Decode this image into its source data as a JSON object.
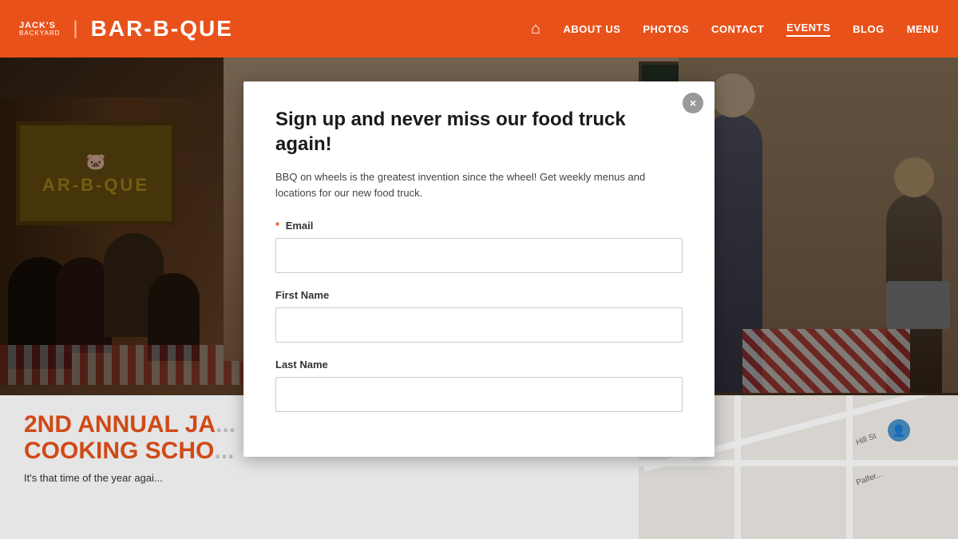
{
  "header": {
    "logo": {
      "line1": "JACK'S",
      "line2": "BACKYARD",
      "separator": "|",
      "brand": "BAR-B-QUE"
    },
    "nav": {
      "home_icon": "🏠",
      "items": [
        {
          "label": "ABOUT US",
          "active": false
        },
        {
          "label": "PHOTOS",
          "active": false
        },
        {
          "label": "CONTACT",
          "active": false
        },
        {
          "label": "EVENTS",
          "active": true
        },
        {
          "label": "BLOG",
          "active": false
        },
        {
          "label": "MENU",
          "active": false
        }
      ]
    }
  },
  "modal": {
    "title": "Sign up and never miss our food truck again!",
    "description": "BBQ on wheels is the greatest invention since the wheel! Get weekly menus and locations for our new food truck.",
    "close_label": "×",
    "fields": [
      {
        "id": "email",
        "label": "Email",
        "required": true,
        "placeholder": ""
      },
      {
        "id": "first_name",
        "label": "First Name",
        "required": false,
        "placeholder": ""
      },
      {
        "id": "last_name",
        "label": "Last Name",
        "required": false,
        "placeholder": ""
      }
    ]
  },
  "page": {
    "event_title_line1": "2ND ANNUAL JA...",
    "event_title_line2": "COOKING SCHO...",
    "event_body": "It's that time of the year agai..."
  },
  "icons": {
    "home": "⌂",
    "close": "×",
    "person": "👤"
  }
}
